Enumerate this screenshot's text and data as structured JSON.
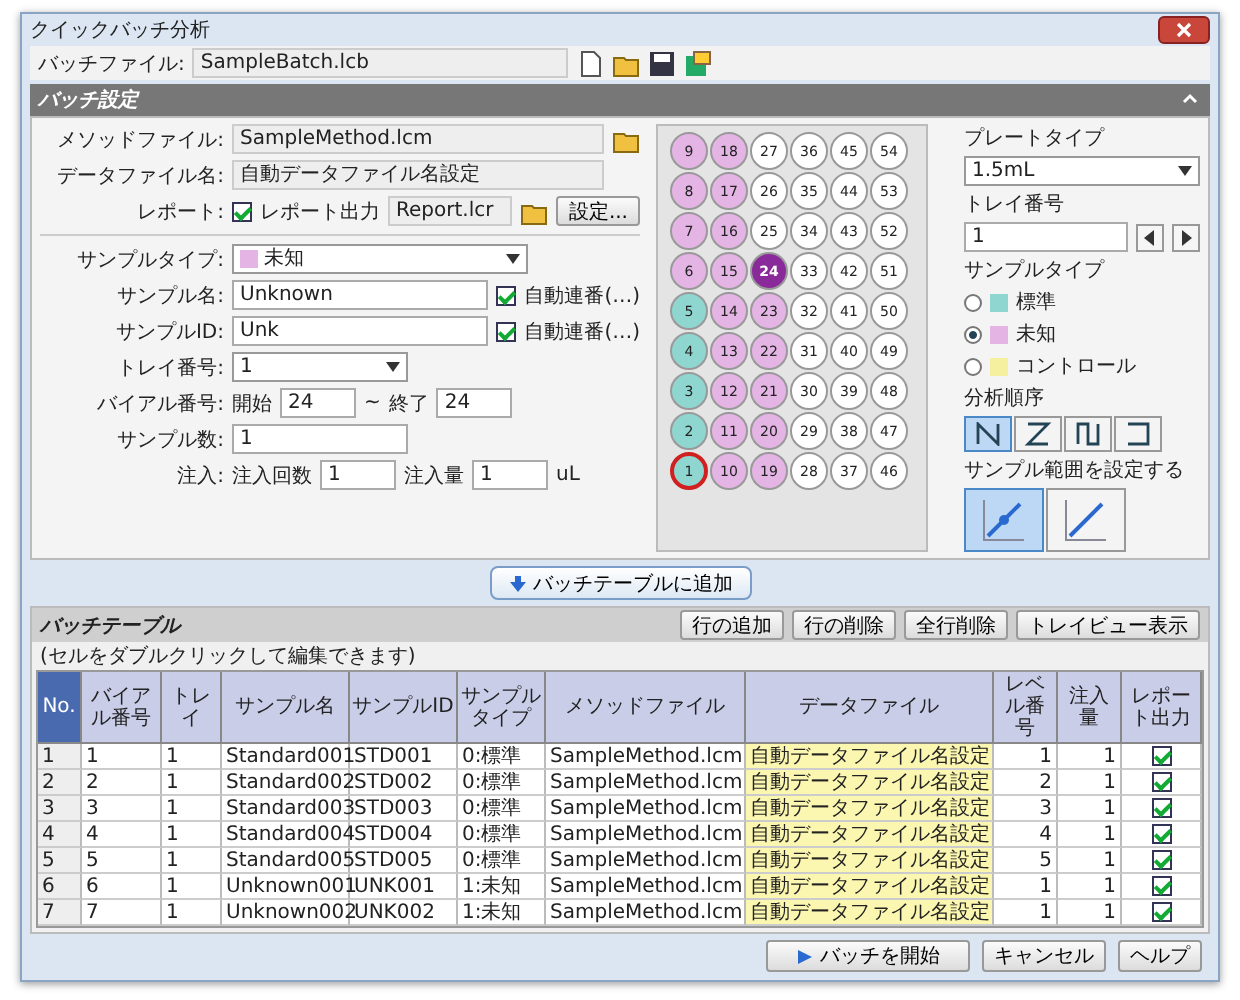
{
  "window": {
    "title": "クイックバッチ分析"
  },
  "batch_file": {
    "label": "バッチファイル:",
    "value": "SampleBatch.lcb"
  },
  "settings": {
    "header": "バッチ設定",
    "method": {
      "label": "メソッドファイル:",
      "value": "SampleMethod.lcm"
    },
    "data_file": {
      "label": "データファイル名:",
      "value": "自動データファイル名設定"
    },
    "report": {
      "label": "レポート:",
      "checkbox_label": "レポート出力",
      "checked": true,
      "value": "Report.lcr",
      "button": "設定..."
    },
    "sample_type": {
      "label": "サンプルタイプ:",
      "value": "未知",
      "color": "#e4b4e4"
    },
    "sample_name": {
      "label": "サンプル名:",
      "value": "Unknown",
      "auto_label": "自動連番(…)",
      "auto_checked": true
    },
    "sample_id": {
      "label": "サンプルID:",
      "value": "Unk",
      "auto_label": "自動連番(…)",
      "auto_checked": true
    },
    "tray": {
      "label": "トレイ番号:",
      "value": "1"
    },
    "vial": {
      "label": "バイアル番号:",
      "start_label": "開始",
      "start": "24",
      "separator": "~",
      "end_label": "終了",
      "end": "24"
    },
    "sample_count": {
      "label": "サンプル数:",
      "value": "1"
    },
    "injection": {
      "label": "注入:",
      "count_label": "注入回数",
      "count": "1",
      "volume_label": "注入量",
      "volume": "1",
      "unit": "uL"
    }
  },
  "plate": {
    "wells": [
      [
        {
          "number": "9",
          "kind": "unknown",
          "selected": false,
          "outlined": false
        },
        {
          "number": "18",
          "kind": "unknown",
          "selected": false,
          "outlined": false
        },
        {
          "number": "27",
          "kind": "none",
          "selected": false,
          "outlined": false
        },
        {
          "number": "36",
          "kind": "none",
          "selected": false,
          "outlined": false
        },
        {
          "number": "45",
          "kind": "none",
          "selected": false,
          "outlined": false
        },
        {
          "number": "54",
          "kind": "none",
          "selected": false,
          "outlined": false
        }
      ],
      [
        {
          "number": "8",
          "kind": "unknown",
          "selected": false,
          "outlined": false
        },
        {
          "number": "17",
          "kind": "unknown",
          "selected": false,
          "outlined": false
        },
        {
          "number": "26",
          "kind": "none",
          "selected": false,
          "outlined": false
        },
        {
          "number": "35",
          "kind": "none",
          "selected": false,
          "outlined": false
        },
        {
          "number": "44",
          "kind": "none",
          "selected": false,
          "outlined": false
        },
        {
          "number": "53",
          "kind": "none",
          "selected": false,
          "outlined": false
        }
      ],
      [
        {
          "number": "7",
          "kind": "unknown",
          "selected": false,
          "outlined": false
        },
        {
          "number": "16",
          "kind": "unknown",
          "selected": false,
          "outlined": false
        },
        {
          "number": "25",
          "kind": "none",
          "selected": false,
          "outlined": false
        },
        {
          "number": "34",
          "kind": "none",
          "selected": false,
          "outlined": false
        },
        {
          "number": "43",
          "kind": "none",
          "selected": false,
          "outlined": false
        },
        {
          "number": "52",
          "kind": "none",
          "selected": false,
          "outlined": false
        }
      ],
      [
        {
          "number": "6",
          "kind": "unknown",
          "selected": false,
          "outlined": false
        },
        {
          "number": "15",
          "kind": "unknown",
          "selected": false,
          "outlined": false
        },
        {
          "number": "24",
          "kind": "unknown",
          "selected": true,
          "outlined": false
        },
        {
          "number": "33",
          "kind": "none",
          "selected": false,
          "outlined": false
        },
        {
          "number": "42",
          "kind": "none",
          "selected": false,
          "outlined": false
        },
        {
          "number": "51",
          "kind": "none",
          "selected": false,
          "outlined": false
        }
      ],
      [
        {
          "number": "5",
          "kind": "standard",
          "selected": false,
          "outlined": false
        },
        {
          "number": "14",
          "kind": "unknown",
          "selected": false,
          "outlined": false
        },
        {
          "number": "23",
          "kind": "unknown",
          "selected": false,
          "outlined": false
        },
        {
          "number": "32",
          "kind": "none",
          "selected": false,
          "outlined": false
        },
        {
          "number": "41",
          "kind": "none",
          "selected": false,
          "outlined": false
        },
        {
          "number": "50",
          "kind": "none",
          "selected": false,
          "outlined": false
        }
      ],
      [
        {
          "number": "4",
          "kind": "standard",
          "selected": false,
          "outlined": false
        },
        {
          "number": "13",
          "kind": "unknown",
          "selected": false,
          "outlined": false
        },
        {
          "number": "22",
          "kind": "unknown",
          "selected": false,
          "outlined": false
        },
        {
          "number": "31",
          "kind": "none",
          "selected": false,
          "outlined": false
        },
        {
          "number": "40",
          "kind": "none",
          "selected": false,
          "outlined": false
        },
        {
          "number": "49",
          "kind": "none",
          "selected": false,
          "outlined": false
        }
      ],
      [
        {
          "number": "3",
          "kind": "standard",
          "selected": false,
          "outlined": false
        },
        {
          "number": "12",
          "kind": "unknown",
          "selected": false,
          "outlined": false
        },
        {
          "number": "21",
          "kind": "unknown",
          "selected": false,
          "outlined": false
        },
        {
          "number": "30",
          "kind": "none",
          "selected": false,
          "outlined": false
        },
        {
          "number": "39",
          "kind": "none",
          "selected": false,
          "outlined": false
        },
        {
          "number": "48",
          "kind": "none",
          "selected": false,
          "outlined": false
        }
      ],
      [
        {
          "number": "2",
          "kind": "standard",
          "selected": false,
          "outlined": false
        },
        {
          "number": "11",
          "kind": "unknown",
          "selected": false,
          "outlined": false
        },
        {
          "number": "20",
          "kind": "unknown",
          "selected": false,
          "outlined": false
        },
        {
          "number": "29",
          "kind": "none",
          "selected": false,
          "outlined": false
        },
        {
          "number": "38",
          "kind": "none",
          "selected": false,
          "outlined": false
        },
        {
          "number": "47",
          "kind": "none",
          "selected": false,
          "outlined": false
        }
      ],
      [
        {
          "number": "1",
          "kind": "standard",
          "selected": false,
          "outlined": true
        },
        {
          "number": "10",
          "kind": "unknown",
          "selected": false,
          "outlined": false
        },
        {
          "number": "19",
          "kind": "unknown",
          "selected": false,
          "outlined": false
        },
        {
          "number": "28",
          "kind": "none",
          "selected": false,
          "outlined": false
        },
        {
          "number": "37",
          "kind": "none",
          "selected": false,
          "outlined": false
        },
        {
          "number": "46",
          "kind": "none",
          "selected": false,
          "outlined": false
        }
      ]
    ]
  },
  "side": {
    "plate_type": {
      "label": "プレートタイプ",
      "value": "1.5mL"
    },
    "tray_no": {
      "label": "トレイ番号",
      "value": "1"
    },
    "sample_type": {
      "label": "サンプルタイプ",
      "options": [
        {
          "label": "標準",
          "color": "#8fd6d0",
          "selected": false
        },
        {
          "label": "未知",
          "color": "#e4b4e4",
          "selected": true
        },
        {
          "label": "コントロール",
          "color": "#f4f0a0",
          "selected": false
        }
      ]
    },
    "order": {
      "label": "分析順序",
      "buttons": [
        {
          "selected": true
        },
        {
          "selected": false
        },
        {
          "selected": false
        },
        {
          "selected": false
        }
      ]
    },
    "range": {
      "label": "サンプル範囲を設定する",
      "buttons": [
        {
          "selected": true
        },
        {
          "selected": false
        }
      ]
    }
  },
  "add_button": "バッチテーブルに追加",
  "table": {
    "title": "バッチテーブル",
    "hint": "(セルをダブルクリックして編集できます)",
    "buttons": [
      "行の追加",
      "行の削除",
      "全行削除",
      "トレイビュー表示"
    ],
    "columns": [
      {
        "label": "No.",
        "kind": "index"
      },
      {
        "label": "バイアル番号",
        "kind": "text"
      },
      {
        "label": "トレイ",
        "kind": "text"
      },
      {
        "label": "サンプル名",
        "kind": "text"
      },
      {
        "label": "サンプルID",
        "kind": "text"
      },
      {
        "label": "サンプルタイプ",
        "kind": "text"
      },
      {
        "label": "メソッドファイル",
        "kind": "text"
      },
      {
        "label": "データファイル",
        "kind": "auto"
      },
      {
        "label": "レベル番号",
        "kind": "num"
      },
      {
        "label": "注入量",
        "kind": "num"
      },
      {
        "label": "レポート出力",
        "kind": "check"
      }
    ],
    "rows": [
      {
        "cells": [
          "1",
          "1",
          "1",
          "Standard001",
          "STD001",
          "0:標準",
          "SampleMethod.lcm",
          "自動データファイル名設定",
          "1",
          "1"
        ],
        "report": true
      },
      {
        "cells": [
          "2",
          "2",
          "1",
          "Standard002",
          "STD002",
          "0:標準",
          "SampleMethod.lcm",
          "自動データファイル名設定",
          "2",
          "1"
        ],
        "report": true
      },
      {
        "cells": [
          "3",
          "3",
          "1",
          "Standard003",
          "STD003",
          "0:標準",
          "SampleMethod.lcm",
          "自動データファイル名設定",
          "3",
          "1"
        ],
        "report": true
      },
      {
        "cells": [
          "4",
          "4",
          "1",
          "Standard004",
          "STD004",
          "0:標準",
          "SampleMethod.lcm",
          "自動データファイル名設定",
          "4",
          "1"
        ],
        "report": true
      },
      {
        "cells": [
          "5",
          "5",
          "1",
          "Standard005",
          "STD005",
          "0:標準",
          "SampleMethod.lcm",
          "自動データファイル名設定",
          "5",
          "1"
        ],
        "report": true
      },
      {
        "cells": [
          "6",
          "6",
          "1",
          "Unknown001",
          "UNK001",
          "1:未知",
          "SampleMethod.lcm",
          "自動データファイル名設定",
          "1",
          "1"
        ],
        "report": true
      },
      {
        "cells": [
          "7",
          "7",
          "1",
          "Unknown002",
          "UNK002",
          "1:未知",
          "SampleMethod.lcm",
          "自動データファイル名設定",
          "1",
          "1"
        ],
        "report": true
      }
    ]
  },
  "footer": [
    {
      "label": "バッチを開始",
      "kind": "start"
    },
    {
      "label": "キャンセル",
      "kind": "plain"
    },
    {
      "label": "ヘルプ",
      "kind": "plain"
    }
  ]
}
